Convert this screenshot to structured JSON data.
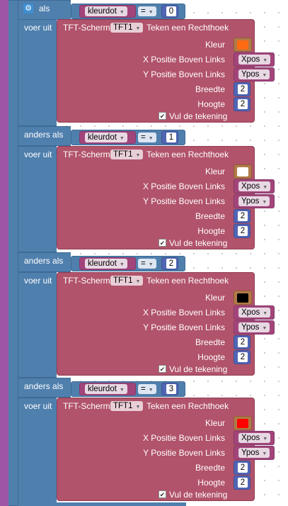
{
  "if_block": {
    "if_label": "als",
    "else_if_label": "anders als",
    "do_label": "voer uit",
    "gear_icon": "gear-icon"
  },
  "conditions": [
    {
      "variable": "kleurdot",
      "operator": "=",
      "value": "0"
    },
    {
      "variable": "kleurdot",
      "operator": "=",
      "value": "1"
    },
    {
      "variable": "kleurdot",
      "operator": "=",
      "value": "2"
    },
    {
      "variable": "kleurdot",
      "operator": "=",
      "value": "3"
    }
  ],
  "draw_block": {
    "component_label": "TFT-Scherm",
    "component_name": "TFT1",
    "action_label": "Teken een Rechthoek",
    "color_label": "Kleur",
    "x_label": "X Positie Boven Links",
    "y_label": "Y Positie Boven Links",
    "width_label": "Breedte",
    "height_label": "Hoogte",
    "fill_label": "Vul de tekening",
    "x_var": "Xpos",
    "y_var": "Ypos",
    "width_value": "2",
    "height_value": "2",
    "fill_checked": true
  },
  "colors": [
    "#ff6a13",
    "#ffffff",
    "#000000",
    "#ff0000"
  ],
  "theme": {
    "procedure_purple": "#9e55a5",
    "control_blue": "#4f7fad",
    "component_red": "#b1536a",
    "variable_magenta": "#a2457a",
    "number_blue": "#5065b3",
    "color_brown": "#b17a48"
  }
}
